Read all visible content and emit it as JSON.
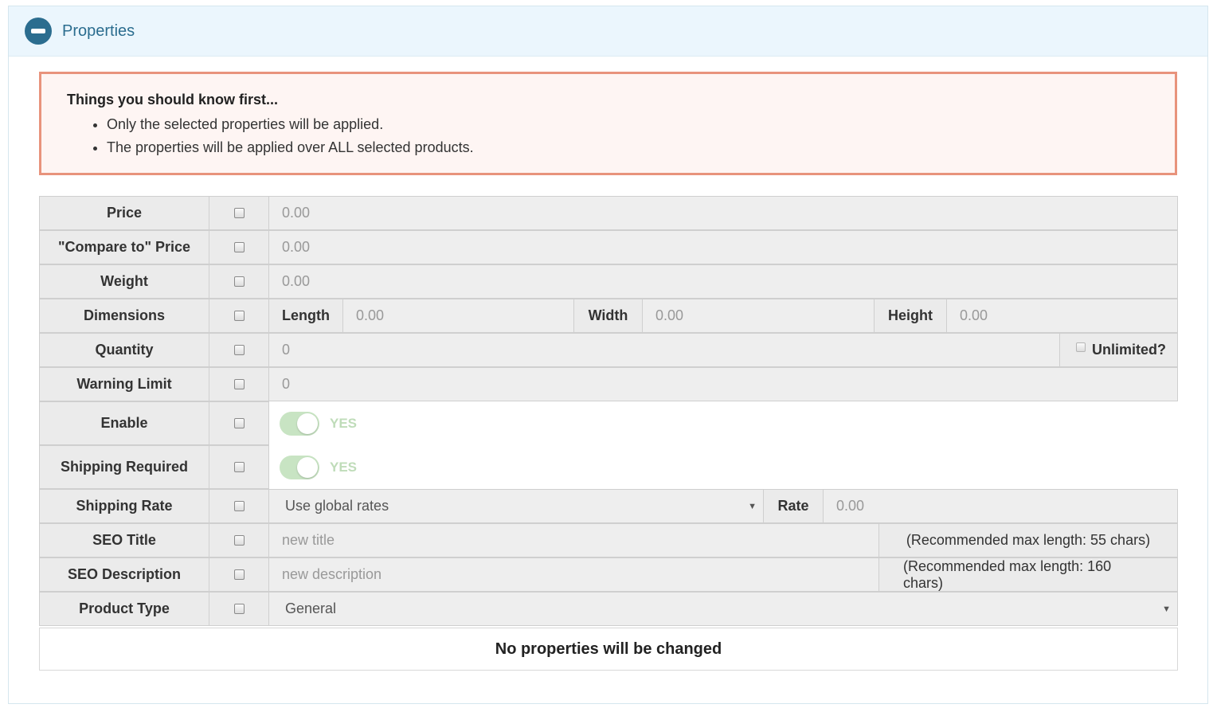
{
  "panel": {
    "title": "Properties",
    "collapse_icon": "minus-circle-icon"
  },
  "notice": {
    "title": "Things you should know first...",
    "items": [
      "Only the selected properties will be applied.",
      "The properties will be applied over ALL selected products."
    ]
  },
  "rows": {
    "price": {
      "label": "Price",
      "placeholder": "0.00"
    },
    "compare_price": {
      "label": "\"Compare to\" Price",
      "placeholder": "0.00"
    },
    "weight": {
      "label": "Weight",
      "placeholder": "0.00"
    },
    "dimensions": {
      "label": "Dimensions",
      "length_label": "Length",
      "length_placeholder": "0.00",
      "width_label": "Width",
      "width_placeholder": "0.00",
      "height_label": "Height",
      "height_placeholder": "0.00"
    },
    "quantity": {
      "label": "Quantity",
      "placeholder": "0",
      "unlimited_label": "Unlimited?"
    },
    "warning_limit": {
      "label": "Warning Limit",
      "placeholder": "0"
    },
    "enable": {
      "label": "Enable",
      "toggle_text": "YES",
      "toggle_on": true
    },
    "shipping_required": {
      "label": "Shipping Required",
      "toggle_text": "YES",
      "toggle_on": true
    },
    "shipping_rate": {
      "label": "Shipping Rate",
      "select_value": "Use global rates",
      "rate_label": "Rate",
      "rate_placeholder": "0.00"
    },
    "seo_title": {
      "label": "SEO Title",
      "placeholder": "new title",
      "hint": "(Recommended max length: 55 chars)"
    },
    "seo_description": {
      "label": "SEO Description",
      "placeholder": "new description",
      "hint": "(Recommended max length: 160 chars)"
    },
    "product_type": {
      "label": "Product Type",
      "select_value": "General"
    }
  },
  "footer": {
    "status": "No properties will be changed"
  },
  "colors": {
    "accent": "#2b6d8f",
    "notice_border": "#e8937c",
    "toggle_on": "#c8e4c3"
  }
}
